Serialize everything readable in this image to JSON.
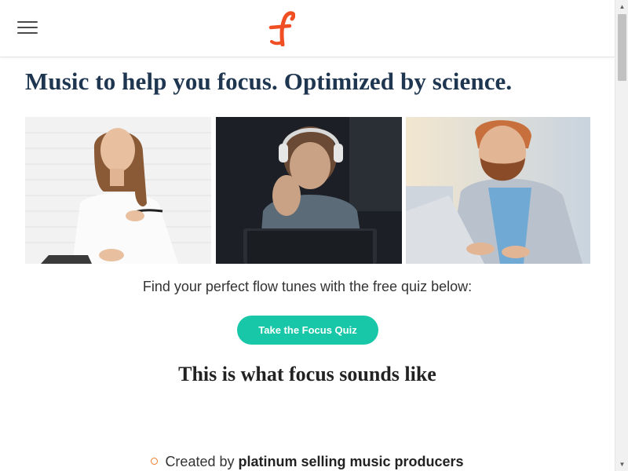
{
  "header": {
    "menu_icon": "hamburger-menu-icon",
    "logo_letter": "f",
    "logo_color": "#f04e23"
  },
  "hero": {
    "title": "Music to help you focus. Optimized by science.",
    "photos": [
      {
        "name": "woman-with-pen-photo"
      },
      {
        "name": "man-with-headphones-laptop-photo"
      },
      {
        "name": "bearded-man-earphones-laptop-photo"
      }
    ]
  },
  "quiz": {
    "intro": "Find your perfect flow tunes with the free quiz below:",
    "button_label": "Take the Focus Quiz",
    "button_color": "#17c7a8"
  },
  "section": {
    "title": "This is what focus sounds like"
  },
  "features": [
    {
      "prefix": "Created by ",
      "bold": "platinum selling music producers",
      "bullet_color": "#f07a2c"
    }
  ],
  "colors": {
    "title_navy": "#1e3650",
    "accent_teal": "#17c7a8",
    "accent_orange": "#f04e23"
  }
}
